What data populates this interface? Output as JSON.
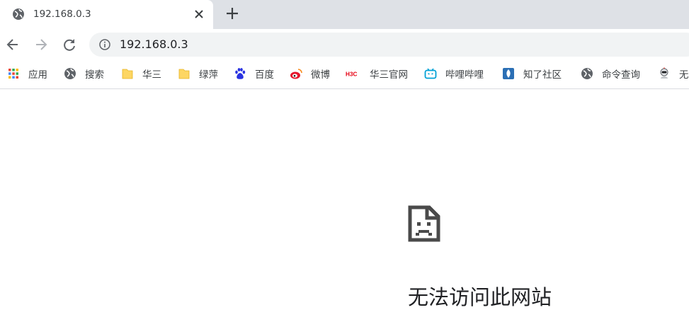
{
  "tab": {
    "title": "192.168.0.3",
    "favicon": "globe-icon"
  },
  "toolbar": {
    "url": "192.168.0.3"
  },
  "bookmarks": [
    {
      "label": "应用",
      "icon": "apps-grid-icon"
    },
    {
      "label": "搜索",
      "icon": "globe-icon"
    },
    {
      "label": "华三",
      "icon": "folder-icon"
    },
    {
      "label": "绿萍",
      "icon": "folder-icon"
    },
    {
      "label": "百度",
      "icon": "baidu-paw-icon"
    },
    {
      "label": "微博",
      "icon": "weibo-icon"
    },
    {
      "label": "华三官网",
      "icon": "h3c-logo-icon"
    },
    {
      "label": "哔哩哔哩",
      "icon": "bilibili-tv-icon"
    },
    {
      "label": "知了社区",
      "icon": "zhiliao-icon"
    },
    {
      "label": "命令查询",
      "icon": "globe-icon"
    },
    {
      "label": "无",
      "icon": "robot-icon"
    }
  ],
  "error": {
    "title": "无法访问此网站",
    "icon": "sad-page-icon"
  },
  "colors": {
    "tabstrip": "#dee1e6",
    "omnibox": "#f1f3f4",
    "text": "#202124",
    "folder": "#fdd663"
  }
}
